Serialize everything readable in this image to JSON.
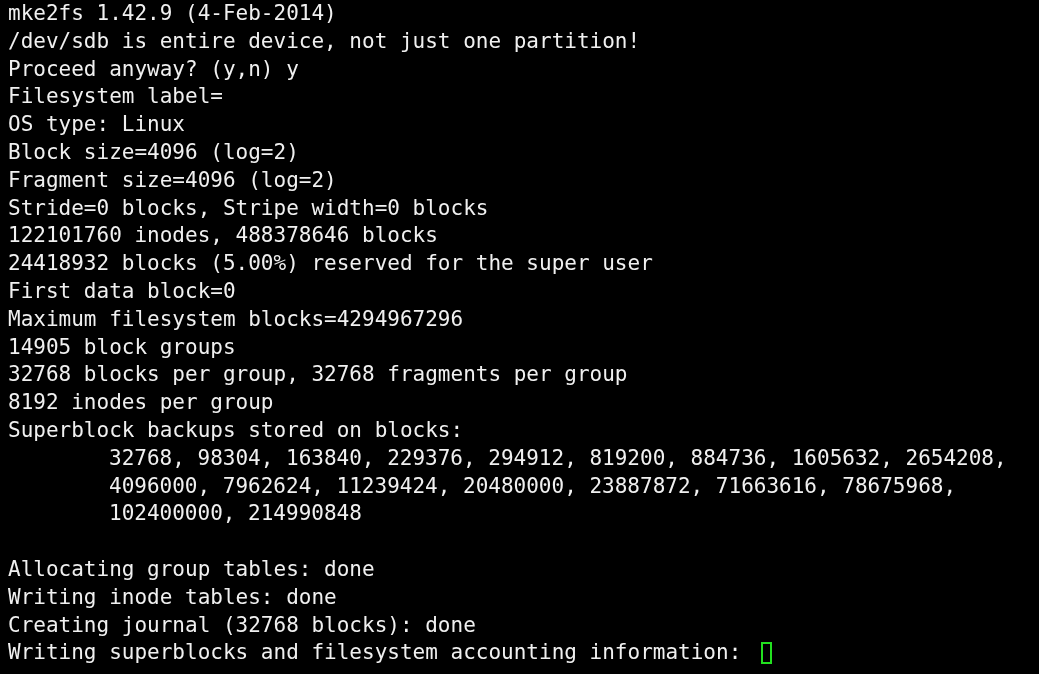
{
  "terminal": {
    "lines": [
      {
        "kind": "plain",
        "text": "mke2fs 1.42.9 (4-Feb-2014)"
      },
      {
        "kind": "plain",
        "text": "/dev/sdb is entire device, not just one partition!"
      },
      {
        "kind": "plain",
        "text": "Proceed anyway? (y,n) y"
      },
      {
        "kind": "plain",
        "text": "Filesystem label="
      },
      {
        "kind": "plain",
        "text": "OS type: Linux"
      },
      {
        "kind": "plain",
        "text": "Block size=4096 (log=2)"
      },
      {
        "kind": "plain",
        "text": "Fragment size=4096 (log=2)"
      },
      {
        "kind": "plain",
        "text": "Stride=0 blocks, Stripe width=0 blocks"
      },
      {
        "kind": "plain",
        "text": "122101760 inodes, 488378646 blocks"
      },
      {
        "kind": "plain",
        "text": "24418932 blocks (5.00%) reserved for the super user"
      },
      {
        "kind": "plain",
        "text": "First data block=0"
      },
      {
        "kind": "plain",
        "text": "Maximum filesystem blocks=4294967296"
      },
      {
        "kind": "plain",
        "text": "14905 block groups"
      },
      {
        "kind": "plain",
        "text": "32768 blocks per group, 32768 fragments per group"
      },
      {
        "kind": "plain",
        "text": "8192 inodes per group"
      },
      {
        "kind": "plain",
        "text": "Superblock backups stored on blocks:"
      },
      {
        "kind": "indented",
        "text": "32768, 98304, 163840, 229376, 294912, 819200, 884736, 1605632, 2654208,"
      },
      {
        "kind": "indented",
        "text": "4096000, 7962624, 11239424, 20480000, 23887872, 71663616, 78675968,"
      },
      {
        "kind": "indented",
        "text": "102400000, 214990848"
      },
      {
        "kind": "blank"
      },
      {
        "kind": "plain",
        "text": "Allocating group tables: done"
      },
      {
        "kind": "plain",
        "text": "Writing inode tables: done"
      },
      {
        "kind": "plain",
        "text": "Creating journal (32768 blocks): done"
      },
      {
        "kind": "plain",
        "text": "Writing superblocks and filesystem accounting information: ",
        "cursor": true
      }
    ]
  }
}
